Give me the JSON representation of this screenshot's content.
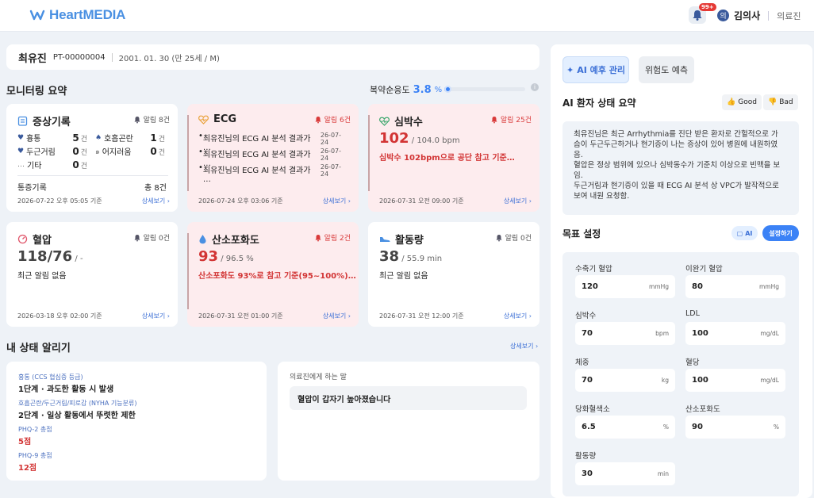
{
  "app": {
    "logo": "HeartMEDIA"
  },
  "header": {
    "badge": "99+",
    "user_name": "김의사",
    "user_role": "의료진",
    "user_icon": "의"
  },
  "patient": {
    "name": "최유진",
    "id": "PT-00000004",
    "dob": "2001. 01. 30  (만 25세 / M)"
  },
  "monitoring": {
    "title": "모니터링 요약",
    "adherence_label": "복약순응도",
    "adherence_value": "3.8",
    "adherence_unit": "%",
    "adherence_pct": 3.8
  },
  "cards": {
    "symptom": {
      "title": "증상기록",
      "alarm": "알림 8건",
      "items": [
        {
          "label": "흉통",
          "count": "5",
          "unit": "건"
        },
        {
          "label": "호흡곤란",
          "count": "1",
          "unit": "건"
        },
        {
          "label": "두근거림",
          "count": "0",
          "unit": "건"
        },
        {
          "label": "어지러움",
          "count": "0",
          "unit": "건"
        },
        {
          "label": "기타",
          "count": "0",
          "unit": "건"
        }
      ],
      "total_label": "통증기록",
      "total_value": "총 8건",
      "foot": "2026-07-22 오후 05:05 기준",
      "more": "상세보기 ›"
    },
    "ecg": {
      "title": "ECG",
      "alarm": "알림 6건",
      "items": [
        {
          "text": "최유진님의 ECG AI 분석 결과가 …",
          "date": "26-07-24"
        },
        {
          "text": "최유진님의 ECG AI 분석 결과가 …",
          "date": "26-07-24"
        },
        {
          "text": "최유진님의 ECG AI 분석 결과가 …",
          "date": "26-07-24"
        }
      ],
      "foot": "2026-07-24 오후 03:06 기준",
      "more": "상세보기 ›"
    },
    "heart": {
      "title": "심박수",
      "alarm": "알림 25건",
      "value": "102",
      "sub": "/ 104.0 bpm",
      "note": "심박수 102bpm으로 공단 참고 기준…",
      "foot": "2026-07-31 오전 09:00 기준",
      "more": "상세보기 ›"
    },
    "bp": {
      "title": "혈압",
      "alarm": "알림 0건",
      "value": "118/76",
      "sub": "/ -",
      "note": "최근 알림 없음",
      "foot": "2026-03-18 오후 02:00 기준",
      "more": "상세보기 ›"
    },
    "spo2": {
      "title": "산소포화도",
      "alarm": "알림 2건",
      "value": "93",
      "sub": "/ 96.5 %",
      "note": "산소포화도 93%로 참고 기준(95~100%)…",
      "foot": "2026-07-31 오전 01:00 기준",
      "more": "상세보기 ›"
    },
    "activity": {
      "title": "활동량",
      "alarm": "알림 0건",
      "value": "38",
      "sub": "/ 55.9 min",
      "note": "최근 알림 없음",
      "foot": "2026-07-31 오전 12:00 기준",
      "more": "상세보기 ›"
    }
  },
  "status": {
    "title": "내 상태 알리기",
    "more": "상세보기 ›",
    "items": [
      {
        "label": "흉통 (CCS 협심증 등급)",
        "value": "1단계 · 과도한 활동 시 발생"
      },
      {
        "label": "호흡곤란/두근거림/피로감 (NYHA 기능분류)",
        "value": "2단계 · 일상 활동에서 뚜렷한 제한"
      },
      {
        "label": "PHQ-2 총점",
        "value": "5점"
      },
      {
        "label": "PHQ-9 총점",
        "value": "12점"
      }
    ],
    "message_title": "의료진에게 하는 말",
    "message": "혈압이 갑자기 높아졌습니다"
  },
  "right": {
    "tab_ai": "AI 예후 관리",
    "tab_risk": "위험도 예측",
    "summary_title": "AI 환자 상태 요약",
    "good": "Good",
    "bad": "Bad",
    "summary_lines": [
      "최유진님은 최근 Arrhythmia를 진단 받은 환자로 간헐적으로 가",
      "슴이 두근두근하거나 현기증이 나는 증상이 있어 병원에 내원하였",
      "음.",
      "혈압은 정상 범위에 있으나 심박동수가 기준치 이상으로 빈맥을 보",
      "임.",
      "두근거림과 현기증이 있을 때 ECG AI 분석 상 VPC가 발작적으로",
      "보여 내원 요청함."
    ],
    "goal_title": "목표 설정",
    "ai_pill": "AI",
    "set_button": "설정하기",
    "goals": [
      {
        "label": "수축기 혈압",
        "value": "120",
        "unit": "mmHg"
      },
      {
        "label": "이완기 혈압",
        "value": "80",
        "unit": "mmHg"
      },
      {
        "label": "심박수",
        "value": "70",
        "unit": "bpm"
      },
      {
        "label": "LDL",
        "value": "100",
        "unit": "mg/dL"
      },
      {
        "label": "체중",
        "value": "70",
        "unit": "kg"
      },
      {
        "label": "혈당",
        "value": "100",
        "unit": "mg/dL"
      },
      {
        "label": "당화혈색소",
        "value": "6.5",
        "unit": "%"
      },
      {
        "label": "산소포화도",
        "value": "90",
        "unit": "%"
      },
      {
        "label": "활동량",
        "value": "30",
        "unit": "min"
      }
    ]
  },
  "colors": {
    "accent": "#3b82f6",
    "alert_bg": "#fdecee",
    "alert_text": "#d23434"
  }
}
